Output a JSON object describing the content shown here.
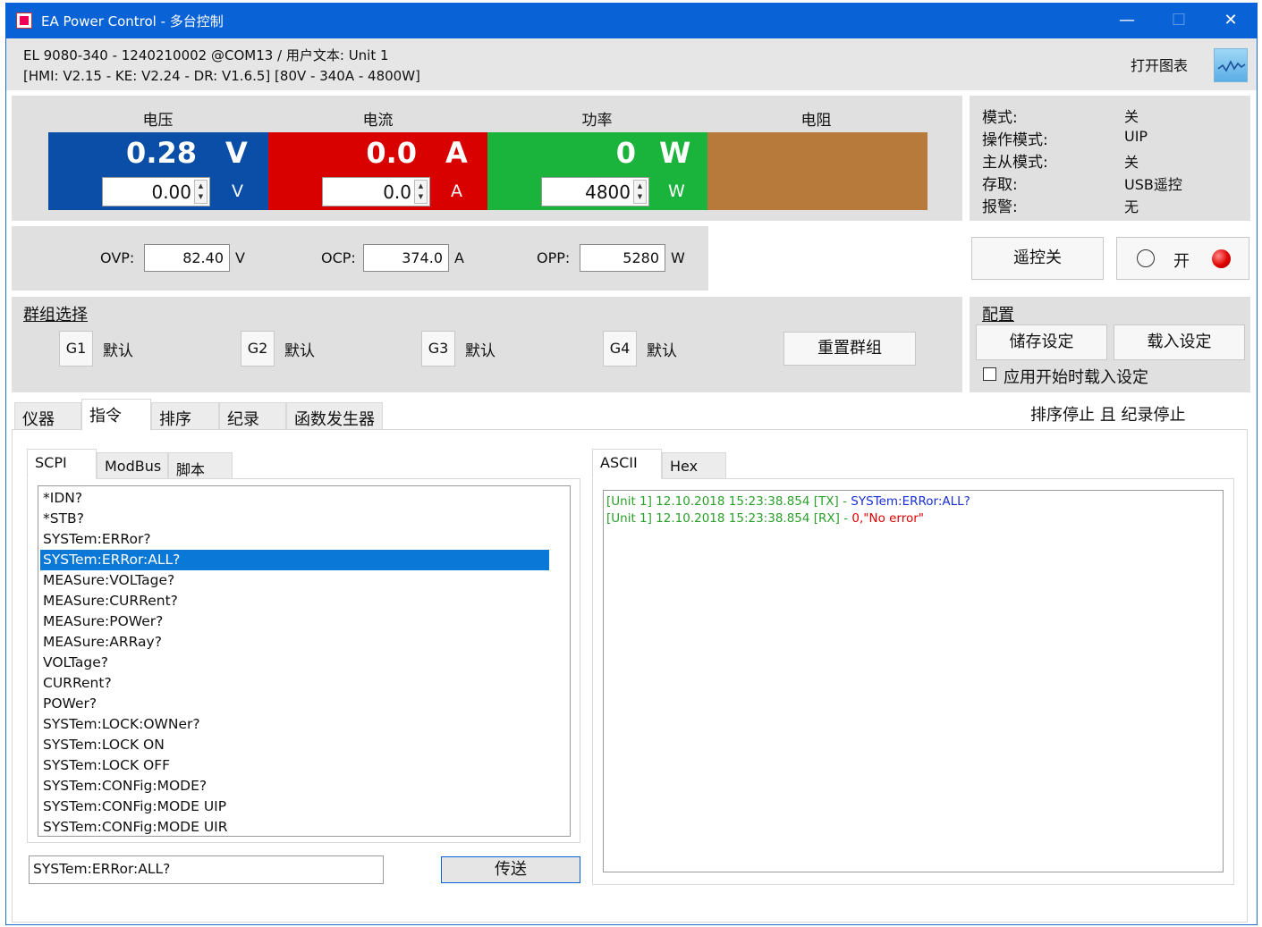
{
  "window": {
    "title": "EA Power Control - 多台控制",
    "minimize": "—",
    "maximize": "☐",
    "close": "✕"
  },
  "device": {
    "line1": "EL 9080-340 - 1240210002 @COM13 / 用户文本: Unit 1",
    "line2": "[HMI: V2.15 - KE: V2.24 - DR: V1.6.5] [80V - 340A - 4800W]",
    "open_chart": "打开图表"
  },
  "measure": {
    "voltage": {
      "label": "电压",
      "value": "0.28",
      "unit": "V",
      "set": "0.00",
      "set_unit": "V",
      "color": "#0a4ea8"
    },
    "current": {
      "label": "电流",
      "value": "0.0",
      "unit": "A",
      "set": "0.0",
      "set_unit": "A",
      "color": "#d90000"
    },
    "power": {
      "label": "功率",
      "value": "0",
      "unit": "W",
      "set": "4800",
      "set_unit": "W",
      "color": "#1ab43c"
    },
    "resistance": {
      "label": "电阻",
      "color": "#b87a3a"
    }
  },
  "status": {
    "mode_label": "模式:",
    "mode_value": "关",
    "opmode_label": "操作模式:",
    "opmode_value": "UIP",
    "ms_label": "主从模式:",
    "ms_value": "关",
    "access_label": "存取:",
    "access_value": "USB遥控",
    "alarm_label": "报警:",
    "alarm_value": "无"
  },
  "protection": {
    "ovp_label": "OVP:",
    "ovp_value": "82.40",
    "ovp_unit": "V",
    "ocp_label": "OCP:",
    "ocp_value": "374.0",
    "ocp_unit": "A",
    "opp_label": "OPP:",
    "opp_value": "5280",
    "opp_unit": "W"
  },
  "remote": {
    "remote_off": "遥控关",
    "on_label": "开"
  },
  "groups": {
    "title": "群组选择",
    "items": [
      {
        "id": "G1",
        "name": "默认"
      },
      {
        "id": "G2",
        "name": "默认"
      },
      {
        "id": "G3",
        "name": "默认"
      },
      {
        "id": "G4",
        "name": "默认"
      }
    ],
    "reset": "重置群组"
  },
  "config": {
    "title": "配置",
    "save": "储存设定",
    "load": "载入设定",
    "autoload": "应用开始时载入设定"
  },
  "tabs": [
    "仪器",
    "指令",
    "排序",
    "纪录",
    "函数发生器"
  ],
  "status_line": "排序停止 且 纪录停止",
  "subtabs": [
    "SCPI",
    "ModBus",
    "脚本"
  ],
  "commands": [
    "*IDN?",
    "*STB?",
    "SYSTem:ERRor?",
    "SYSTem:ERRor:ALL?",
    "MEASure:VOLTage?",
    "MEASure:CURRent?",
    "MEASure:POWer?",
    "MEASure:ARRay?",
    "VOLTage?",
    "CURRent?",
    "POWer?",
    "SYSTem:LOCK:OWNer?",
    "SYSTem:LOCK ON",
    "SYSTem:LOCK OFF",
    "SYSTem:CONFig:MODE?",
    "SYSTem:CONFig:MODE UIP",
    "SYSTem:CONFig:MODE UIR"
  ],
  "command_input": "SYSTem:ERRor:ALL?",
  "send": "传送",
  "log_tabs": [
    "ASCII",
    "Hex"
  ],
  "log": [
    {
      "prefix": "[Unit 1] 12.10.2018  15:23:38.854  [TX] - ",
      "msg": "SYSTem:ERRor:ALL?",
      "msg_color": "#1a2fd0"
    },
    {
      "prefix": "[Unit 1] 12.10.2018  15:23:38.854  [RX] - ",
      "msg": "0,\"No error\"",
      "msg_color": "#e00000"
    }
  ],
  "colors": {
    "log_prefix": "#2aa02a",
    "titlebar": "#0a63d6",
    "selection": "#0a78d7"
  }
}
